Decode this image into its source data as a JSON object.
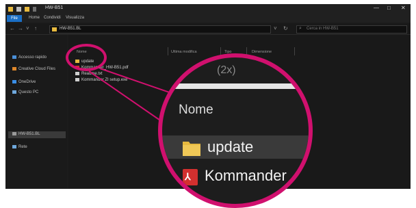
{
  "window": {
    "title": "HW-B51",
    "controls": {
      "minimize": "—",
      "maximize": "□",
      "close": "✕"
    }
  },
  "ribbon": {
    "tabs": [
      "File",
      "Home",
      "Condividi",
      "Visualizza"
    ]
  },
  "address": {
    "path": "HW-B51.BL",
    "search_placeholder": "Cerca in HW-B51"
  },
  "nav": {
    "items": [
      {
        "label": "Accesso rapido",
        "icon": "star-icon",
        "color": "#4a8fd8"
      },
      {
        "label": "Creative Cloud Files",
        "icon": "creative-cloud-icon",
        "color": "#e0882a"
      },
      {
        "label": "OneDrive",
        "icon": "cloud-icon",
        "color": "#3a8ee6"
      },
      {
        "label": "Questo PC",
        "icon": "computer-icon",
        "color": "#6fa8dc"
      },
      {
        "label": "HW-B51.BL",
        "icon": "drive-icon",
        "color": "#9a9a9a"
      },
      {
        "label": "Rete",
        "icon": "network-icon",
        "color": "#6fa8dc"
      }
    ]
  },
  "filelist": {
    "columns": [
      "Nome",
      "Ultima modifica",
      "Tipo",
      "Dimensione"
    ],
    "rows": [
      {
        "name": "update",
        "icon": "folder-icon",
        "color": "#e7b93f"
      },
      {
        "name": "Kommander_HW-B51.pdf",
        "icon": "pdf-icon",
        "color": "#d3302f"
      },
      {
        "name": "Readme.txt",
        "icon": "document-icon",
        "color": "#cfcfcf"
      },
      {
        "name": "Kommander ZI setup.exe",
        "icon": "document-icon",
        "color": "#cfcfcf"
      }
    ]
  },
  "zoom": {
    "top_text": "(2x)",
    "header": "Nome",
    "row1": "update",
    "row2": "Kommander"
  },
  "colors": {
    "highlight": "#d0106e",
    "accent": "#1a6fc6"
  }
}
